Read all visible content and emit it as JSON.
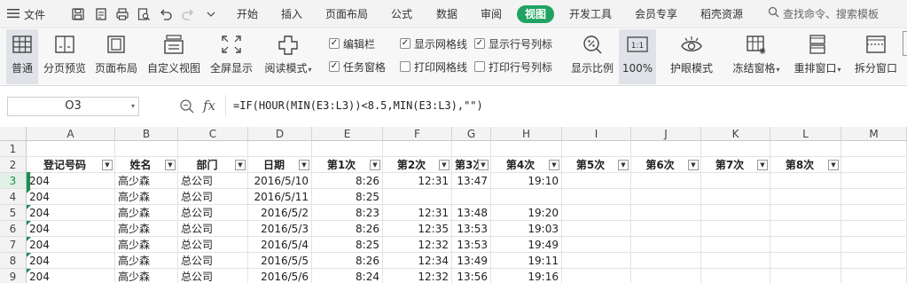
{
  "menubar": {
    "file_label": "文件",
    "tabs": [
      {
        "label": "开始",
        "active": false
      },
      {
        "label": "插入",
        "active": false
      },
      {
        "label": "页面布局",
        "active": false
      },
      {
        "label": "公式",
        "active": false
      },
      {
        "label": "数据",
        "active": false
      },
      {
        "label": "审阅",
        "active": false
      },
      {
        "label": "视图",
        "active": true
      },
      {
        "label": "开发工具",
        "active": false
      },
      {
        "label": "会员专享",
        "active": false
      },
      {
        "label": "稻壳资源",
        "active": false
      }
    ],
    "search_placeholder": "查找命令、搜索模板",
    "accent_color": "#1fa362"
  },
  "ribbon": {
    "buttons": [
      {
        "label": "普通",
        "icon": "normal-view-icon"
      },
      {
        "label": "分页预览",
        "icon": "page-break-preview-icon"
      },
      {
        "label": "页面布局",
        "icon": "page-layout-icon"
      },
      {
        "label": "自定义视图",
        "icon": "custom-view-icon"
      },
      {
        "label": "全屏显示",
        "icon": "fullscreen-icon"
      },
      {
        "label": "阅读模式",
        "icon": "reading-mode-icon"
      },
      {
        "label": "显示比例",
        "icon": "zoom-percent-icon"
      },
      {
        "label": "100%",
        "icon": "zoom-100-icon"
      },
      {
        "label": "护眼模式",
        "icon": "eye-protection-icon"
      },
      {
        "label": "冻结窗格",
        "icon": "freeze-panes-icon"
      },
      {
        "label": "重排窗口",
        "icon": "arrange-windows-icon"
      },
      {
        "label": "拆分窗口",
        "icon": "split-window-icon"
      }
    ],
    "checks": [
      {
        "label": "编辑栏",
        "checked": true
      },
      {
        "label": "任务窗格",
        "checked": true
      },
      {
        "label": "显示网格线",
        "checked": true
      },
      {
        "label": "打印网格线",
        "checked": false
      },
      {
        "label": "显示行号列标",
        "checked": true
      },
      {
        "label": "打印行号列标",
        "checked": false
      }
    ]
  },
  "formula_bar": {
    "name_box": "O3",
    "fx": "fx",
    "formula": "=IF(HOUR(MIN(E3:L3))<8.5,MIN(E3:L3),\"\")"
  },
  "sheet": {
    "columns": [
      "A",
      "B",
      "C",
      "D",
      "E",
      "F",
      "G",
      "H",
      "I",
      "J",
      "K",
      "L",
      "M"
    ],
    "row_numbers": [
      "1",
      "2",
      "3",
      "4",
      "5",
      "6",
      "7",
      "8",
      "9"
    ],
    "headers": [
      "登记号码",
      "姓名",
      "部门",
      "日期",
      "第1次",
      "第2次",
      "第3次",
      "第4次",
      "第5次",
      "第6次",
      "第7次",
      "第8次"
    ],
    "rows": [
      [
        "204",
        "高少森",
        "总公司",
        "2016/5/10",
        "8:26",
        "12:31",
        "13:47",
        "19:10"
      ],
      [
        "204",
        "高少森",
        "总公司",
        "2016/5/11",
        "8:25",
        "",
        "",
        ""
      ],
      [
        "204",
        "高少森",
        "总公司",
        "2016/5/2",
        "8:23",
        "12:31",
        "13:48",
        "19:20"
      ],
      [
        "204",
        "高少森",
        "总公司",
        "2016/5/3",
        "8:26",
        "12:35",
        "13:53",
        "19:03"
      ],
      [
        "204",
        "高少森",
        "总公司",
        "2016/5/4",
        "8:25",
        "12:32",
        "13:53",
        "19:49"
      ],
      [
        "204",
        "高少森",
        "总公司",
        "2016/5/5",
        "8:26",
        "12:34",
        "13:49",
        "19:11"
      ],
      [
        "204",
        "高少森",
        "总公司",
        "2016/5/6",
        "8:24",
        "12:32",
        "13:56",
        "19:16"
      ]
    ],
    "selection_color": "#1a8f52"
  }
}
